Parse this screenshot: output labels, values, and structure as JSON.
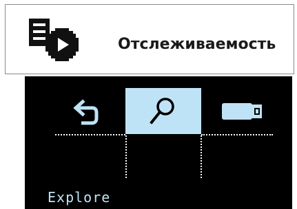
{
  "header": {
    "title": "Отслеживаемость",
    "icon": "traceability-document-play-icon"
  },
  "screen": {
    "menu": [
      {
        "id": "back",
        "icon": "back-arrow-icon",
        "selected": false
      },
      {
        "id": "search",
        "icon": "search-icon",
        "selected": true
      },
      {
        "id": "usb",
        "icon": "usb-drive-icon",
        "selected": false
      }
    ],
    "status_label": "Explore"
  },
  "colors": {
    "screen_background": "#000000",
    "highlight": "#bfe3f6",
    "foreground": "#ffffff",
    "card_border": "#8a8a8a"
  }
}
